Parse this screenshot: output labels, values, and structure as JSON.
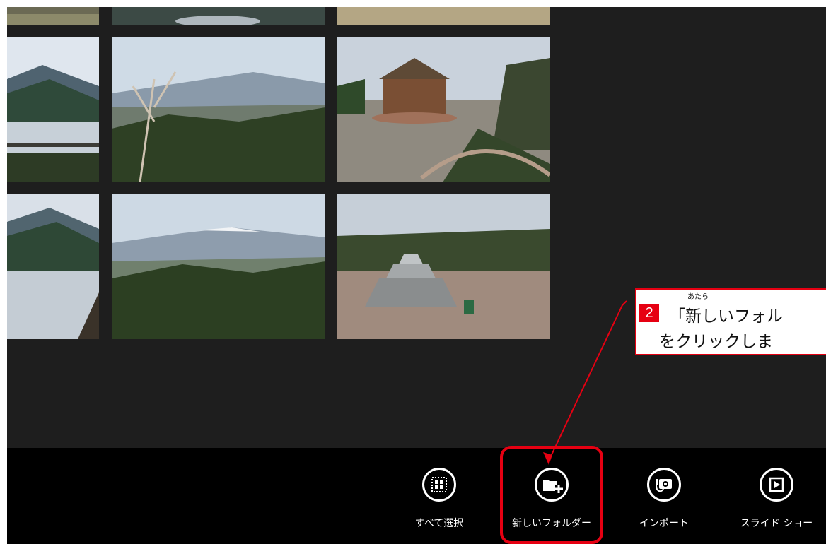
{
  "app_bar": {
    "commands": [
      {
        "label": "すべて選択",
        "icon": "select-all-icon"
      },
      {
        "label": "新しいフォルダー",
        "icon": "new-folder-icon"
      },
      {
        "label": "インポート",
        "icon": "import-camera-icon"
      },
      {
        "label": "スライド ショー",
        "icon": "slideshow-icon"
      }
    ]
  },
  "callout": {
    "step": "2",
    "line1": "「新しいフォル",
    "ruby": "あたら",
    "line2": "をクリックしま"
  },
  "colors": {
    "background": "#1e1e1e",
    "app_bar": "#000000",
    "annotation": "#e60012"
  }
}
